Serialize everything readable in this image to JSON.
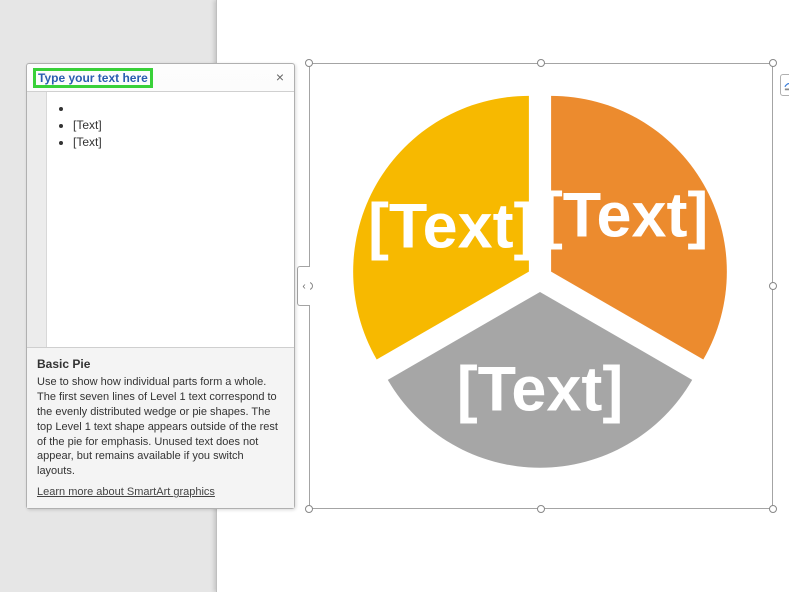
{
  "text_pane": {
    "title": "Type your text here",
    "bullets": [
      "",
      "[Text]",
      "[Text]"
    ],
    "desc_title": "Basic Pie",
    "desc_body": "Use to show how individual parts form a whole. The first seven lines of Level 1 text correspond to the evenly distributed wedge or pie shapes. The top Level 1 text shape appears outside of the rest of the pie for emphasis. Unused text does not appear, but remains available if you switch layouts.",
    "link": "Learn more about SmartArt graphics"
  },
  "chart_data": {
    "type": "pie",
    "title": "",
    "series": [
      {
        "name": "[Text]",
        "value": 1,
        "color": "#ec8b2e"
      },
      {
        "name": "[Text]",
        "value": 1,
        "color": "#a6a6a6"
      },
      {
        "name": "[Text]",
        "value": 1,
        "color": "#f7b900"
      }
    ]
  }
}
